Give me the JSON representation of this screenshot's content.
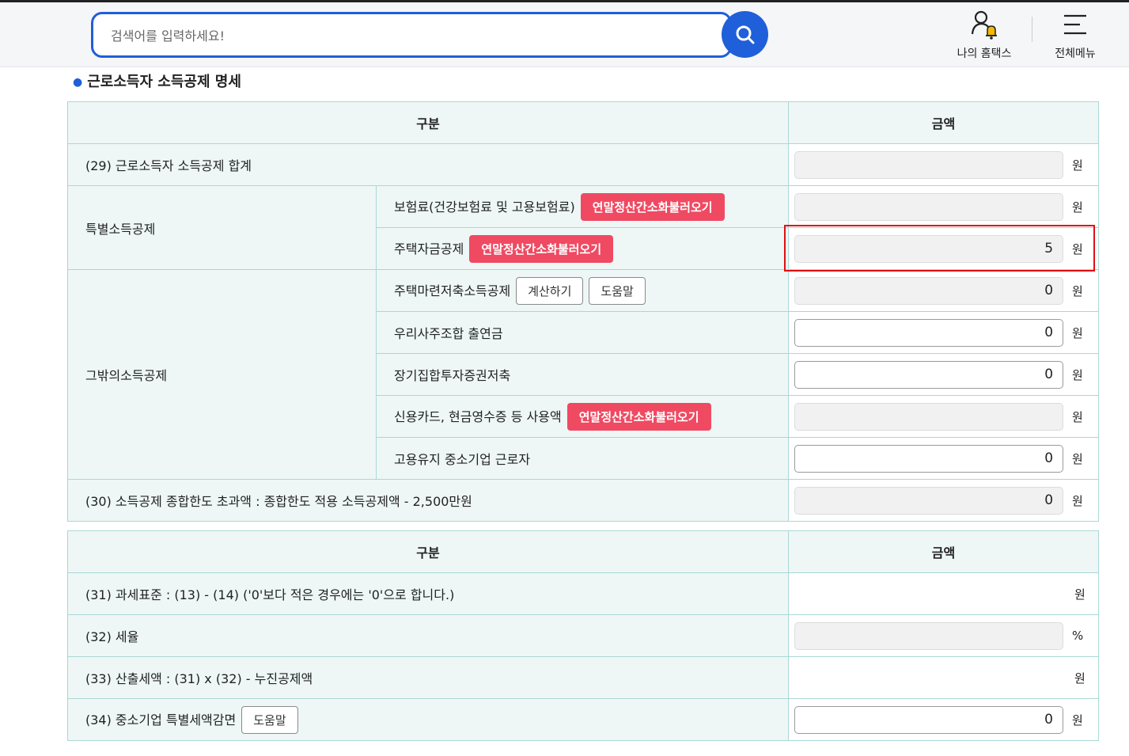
{
  "search": {
    "placeholder": "검색어를 입력하세요!"
  },
  "header": {
    "my_hometax": "나의 홈택스",
    "all_menu": "전체메뉴"
  },
  "section": {
    "title": "근로소득자 소득공제 명세"
  },
  "table1": {
    "col_category": "구분",
    "col_amount": "금액",
    "row29": {
      "label": "(29) 근로소득자 소득공제 합계",
      "value": "",
      "unit": "원"
    },
    "special": {
      "group": "특별소득공제",
      "insurance": {
        "label": "보험료(건강보험료 및 고용보험료)",
        "button": "연말정산간소화불러오기",
        "value": "",
        "unit": "원"
      },
      "housing_fund": {
        "label": "주택자금공제",
        "button": "연말정산간소화불러오기",
        "value": "5",
        "unit": "원"
      }
    },
    "other": {
      "group": "그밖의소득공제",
      "housing_savings": {
        "label": "주택마련저축소득공제",
        "calc_button": "계산하기",
        "help_button": "도움말",
        "value": "0",
        "unit": "원"
      },
      "employee_stock": {
        "label": "우리사주조합 출연금",
        "value": "0",
        "unit": "원"
      },
      "long_term_fund": {
        "label": "장기집합투자증권저축",
        "value": "0",
        "unit": "원"
      },
      "credit_card": {
        "label": "신용카드, 현금영수증 등 사용액",
        "button": "연말정산간소화불러오기",
        "value": "",
        "unit": "원"
      },
      "sme_employment": {
        "label": "고용유지 중소기업 근로자",
        "value": "0",
        "unit": "원"
      }
    },
    "row30": {
      "label": "(30) 소득공제 종합한도 초과액 : 종합한도 적용 소득공제액 - 2,500만원",
      "value": "0",
      "unit": "원"
    }
  },
  "table2": {
    "col_category": "구분",
    "col_amount": "금액",
    "row31": {
      "label": "(31) 과세표준 : (13) - (14) ('0'보다 적은 경우에는 '0'으로 합니다.)",
      "unit": "원"
    },
    "row32": {
      "label": "(32) 세율",
      "value": "",
      "unit": "%"
    },
    "row33": {
      "label": "(33) 산출세액 : (31) x (32) - 누진공제액",
      "unit": "원"
    },
    "row34": {
      "label": "(34) 중소기업 특별세액감면",
      "help_button": "도움말",
      "value": "0",
      "unit": "원"
    }
  },
  "colors": {
    "accent": "#1f5fd9",
    "red_button": "#ef4a62",
    "highlight": "#e01010",
    "header_bg": "#eef7f6"
  }
}
